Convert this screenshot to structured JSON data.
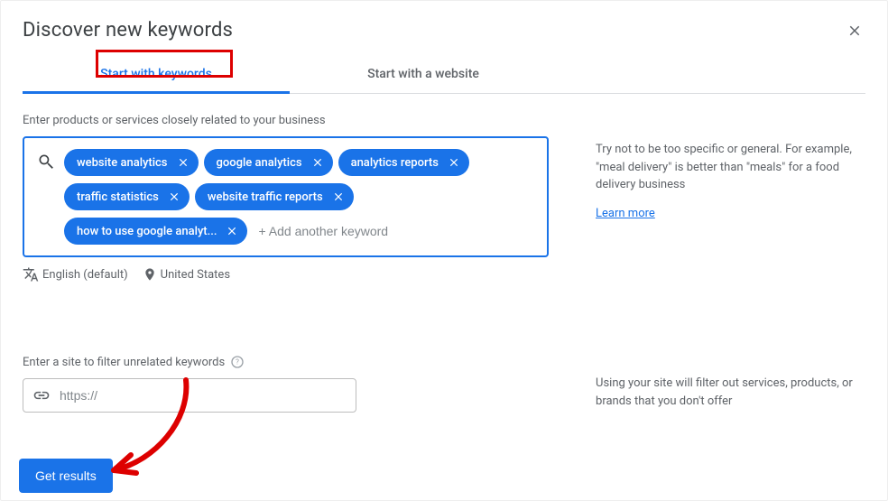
{
  "header": {
    "title": "Discover new keywords"
  },
  "tabs": [
    {
      "label": "Start with keywords",
      "active": true
    },
    {
      "label": "Start with a website",
      "active": false
    }
  ],
  "keywords": {
    "label": "Enter products or services closely related to your business",
    "chips": [
      "website analytics",
      "google analytics",
      "analytics reports",
      "traffic statistics",
      "website traffic reports",
      "how to use google analyt..."
    ],
    "add_placeholder": "+ Add another keyword"
  },
  "filters": {
    "language": "English (default)",
    "location": "United States"
  },
  "keyword_tip": {
    "text": "Try not to be too specific or general. For example, \"meal delivery\" is better than \"meals\" for a food delivery business",
    "link": "Learn more"
  },
  "site": {
    "label": "Enter a site to filter unrelated keywords",
    "placeholder": "https://"
  },
  "site_tip": {
    "text": "Using your site will filter out services, products, or brands that you don't offer"
  },
  "actions": {
    "get_results": "Get results"
  }
}
